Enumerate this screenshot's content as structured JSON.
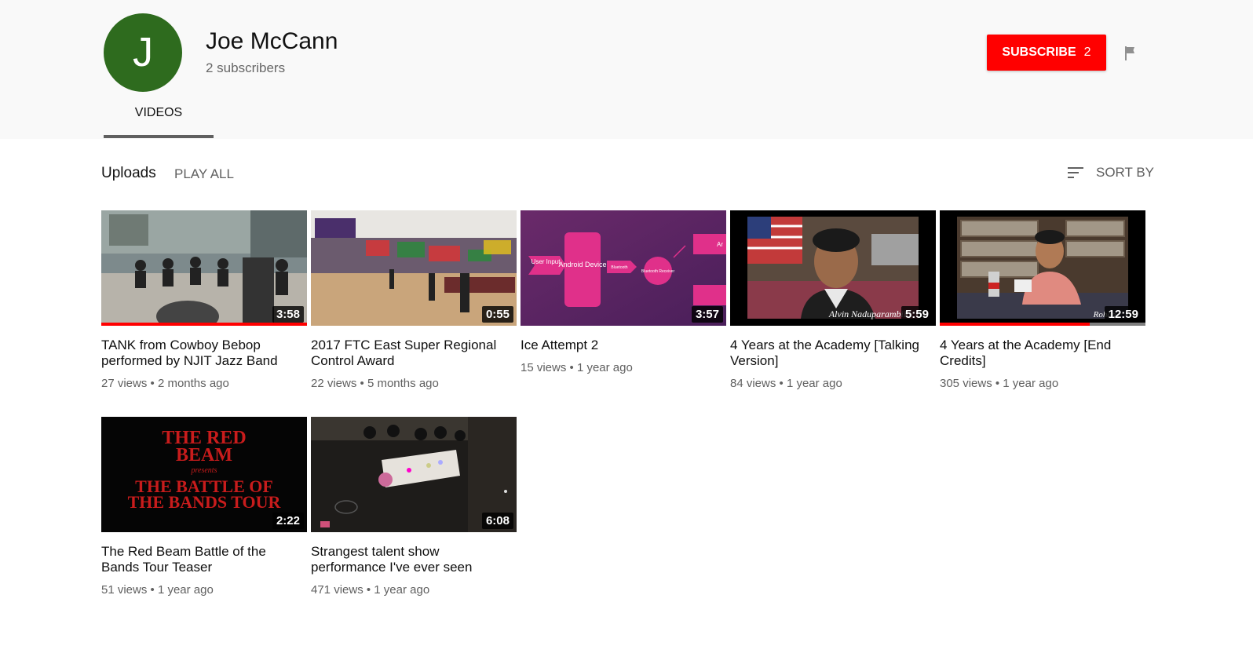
{
  "channel": {
    "avatar_letter": "J",
    "name": "Joe McCann",
    "subscribers": "2 subscribers",
    "subscribe_label": "SUBSCRIBE",
    "subscribe_count": "2",
    "tab": "VIDEOS"
  },
  "uploads": {
    "title": "Uploads",
    "play_all": "PLAY ALL",
    "sort_by": "SORT BY"
  },
  "colors": {
    "subscribe": "#ff0000",
    "avatar": "#2e6b1e"
  },
  "videos": [
    {
      "title": "TANK from Cowboy Bebop performed by NJIT Jazz Band",
      "duration": "3:58",
      "views": "27 views",
      "age": "2 months ago",
      "watched": 1.0
    },
    {
      "title": "2017 FTC East Super Regional Control Award",
      "duration": "0:55",
      "views": "22 views",
      "age": "5 months ago",
      "watched": 0
    },
    {
      "title": "Ice Attempt 2",
      "duration": "3:57",
      "views": "15 views",
      "age": "1 year ago",
      "watched": 0,
      "thumb_text": {
        "user_input": "User Input",
        "android": "Android Device",
        "bluetooth": "Bluetooth",
        "receiver": "Bluetooth Receiver",
        "ar": "Ar"
      }
    },
    {
      "title": "4 Years at the Academy [Talking Version]",
      "duration": "5:59",
      "views": "84 views",
      "age": "1 year ago",
      "watched": 0,
      "thumb_text": {
        "caption": "Alvin Naduparambil"
      }
    },
    {
      "title": "4 Years at the Academy [End Credits]",
      "duration": "12:59",
      "views": "305 views",
      "age": "1 year ago",
      "watched": 0.73,
      "thumb_text": {
        "caption": "Rohan"
      }
    },
    {
      "title": "The Red Beam Battle of the Bands Tour Teaser",
      "duration": "2:22",
      "views": "51 views",
      "age": "1 year ago",
      "watched": 0,
      "thumb_text": {
        "line1": "THE RED",
        "line2": "BEAM",
        "line3": "presents",
        "line4": "THE BATTLE OF",
        "line5": "THE BANDS TOUR"
      }
    },
    {
      "title": "Strangest talent show performance I've ever seen",
      "duration": "6:08",
      "views": "471 views",
      "age": "1 year ago",
      "watched": 0
    }
  ]
}
